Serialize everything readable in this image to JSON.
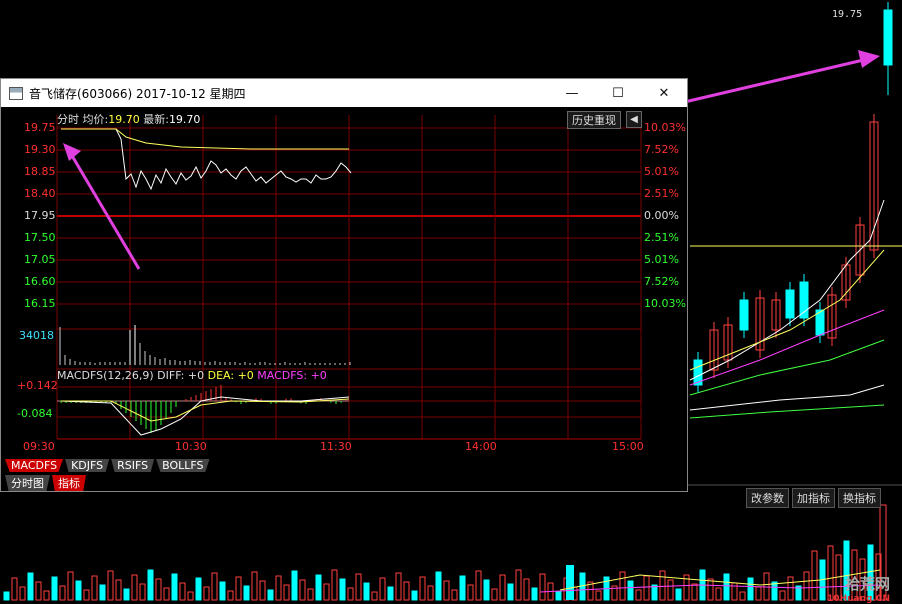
{
  "price_tag": "19.75",
  "buttons": [
    "改参数",
    "加指标",
    "换指标"
  ],
  "watermark": {
    "site": "拾荒网",
    "url": "10Huang.CN"
  },
  "window": {
    "title": "音飞储存(603066) 2017-10-12 星期四",
    "minimize_icon": "minimize-icon",
    "maximize_icon": "maximize-icon",
    "close_icon": "close-icon"
  },
  "header": {
    "mode": "分时",
    "avg_label": "均价:",
    "avg_value": "19.70",
    "latest_label": "最新:",
    "latest_value": "19.70",
    "history_button": "历史重现"
  },
  "price_axis_left": [
    "19.75",
    "19.30",
    "18.85",
    "18.40",
    "17.95",
    "17.50",
    "17.05",
    "16.60",
    "16.15"
  ],
  "pct_axis_right": [
    "10.03%",
    "7.52%",
    "5.01%",
    "2.51%",
    "0.00%",
    "2.51%",
    "5.01%",
    "7.52%",
    "10.03%"
  ],
  "volume_axis": "34018",
  "macd_header": {
    "name": "MACDFS(12,26,9)",
    "diff": "DIFF: +0",
    "dea": "DEA: +0",
    "macdfs": "MACDFS: +0"
  },
  "macd_axis": [
    "+0.142",
    "-0.084"
  ],
  "time_axis": [
    "09:30",
    "10:30",
    "11:30",
    "14:00",
    "15:00"
  ],
  "indicator_tabs": [
    "MACDFS",
    "KDJFS",
    "RSIFS",
    "BOLLFS"
  ],
  "bottom_tabs": [
    "分时图",
    "指标"
  ],
  "colors": {
    "up": "#ff3030",
    "down": "#00ffff",
    "grid": "#8b0000",
    "avg": "#ffff40",
    "price": "#ffffff",
    "arrow": "#e040e0"
  }
}
